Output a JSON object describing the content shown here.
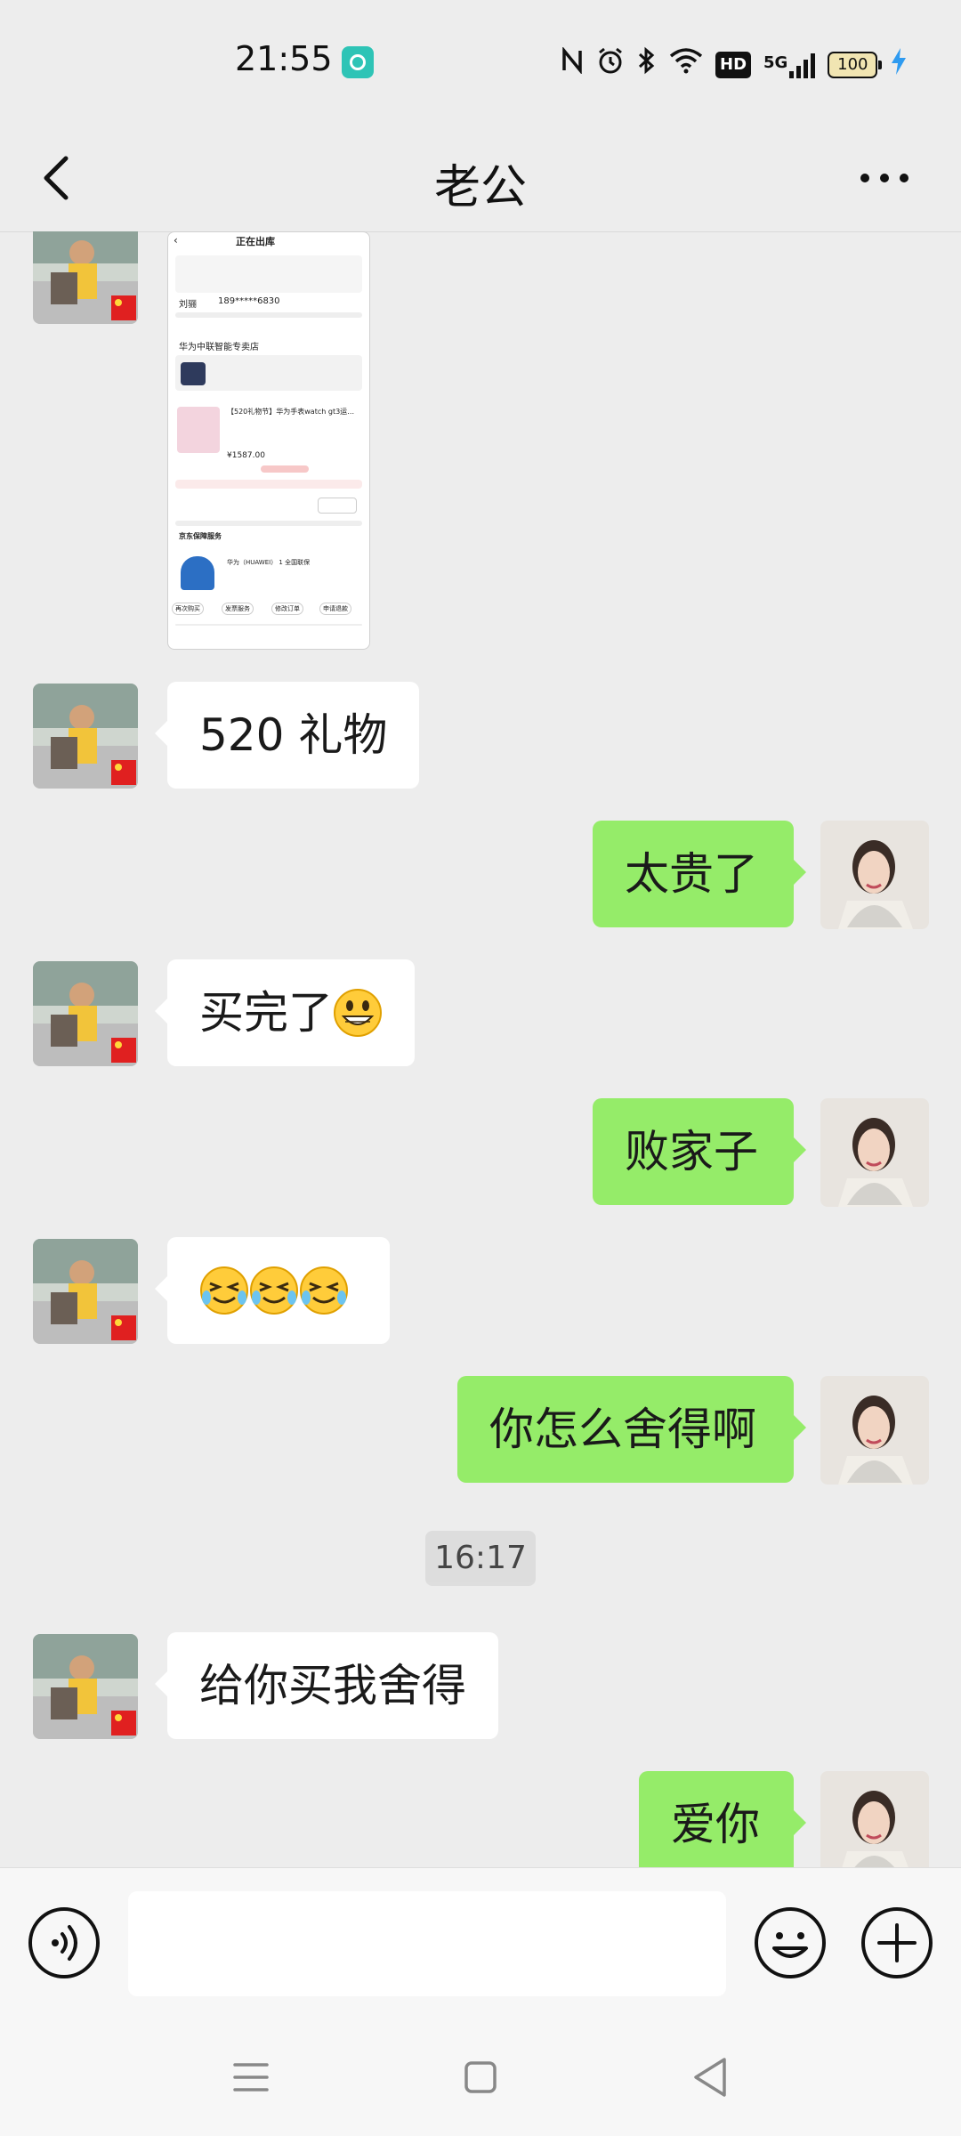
{
  "status_bar": {
    "time": "21:55",
    "network": "5G",
    "hd": "HD",
    "battery": "100"
  },
  "header": {
    "title": "老公"
  },
  "messages": [
    {
      "text": "520 礼物"
    },
    {
      "text": "太贵了"
    },
    {
      "text": "买完了"
    },
    {
      "text": "败家子"
    },
    {
      "text": "你怎么舍得啊"
    },
    {
      "timestamp": "16:17"
    },
    {
      "text": "给你买我舍得"
    },
    {
      "text": "爱你"
    }
  ],
  "shared_screenshot": {
    "title": "正在出库",
    "name": "刘骊",
    "phone": "189*****6830",
    "store": "华为中联智能专卖店",
    "product": "【520礼物节】华为手表watch gt3运…",
    "price": "¥1587.00",
    "insurance": "京东保障服务",
    "insurance_item": "华为（HUAWEI） 1 全国联保",
    "buttons": [
      "再次购买",
      "发票服务",
      "修改订单",
      "申请退款"
    ]
  },
  "input": {
    "placeholder": ""
  },
  "colors": {
    "bubble_out": "#95ec69",
    "bubble_in": "#ffffff",
    "background": "#ededed"
  }
}
